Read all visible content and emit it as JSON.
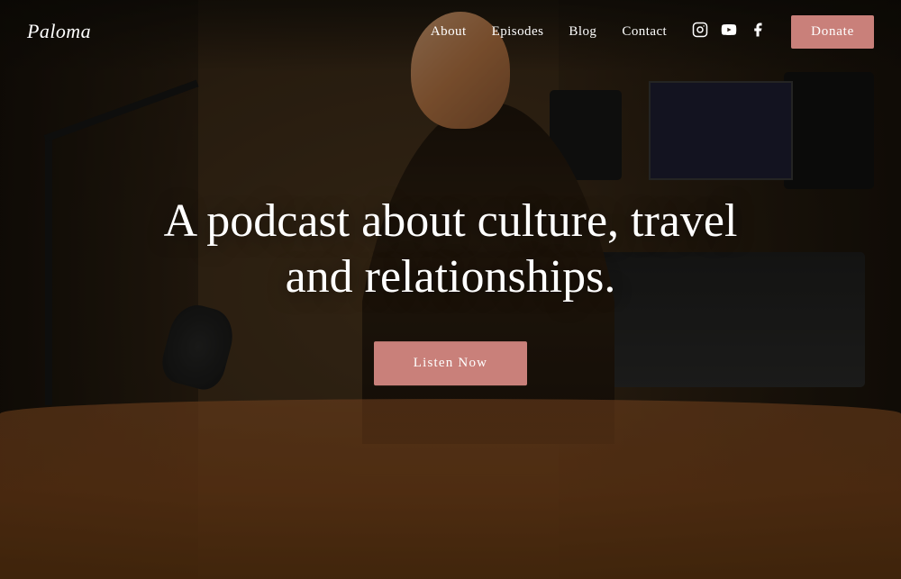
{
  "brand": {
    "name": "Paloma"
  },
  "nav": {
    "links": [
      {
        "label": "About",
        "name": "about"
      },
      {
        "label": "Episodes",
        "name": "episodes"
      },
      {
        "label": "Blog",
        "name": "blog"
      },
      {
        "label": "Contact",
        "name": "contact"
      }
    ],
    "donate_label": "Donate",
    "icons": [
      "instagram",
      "youtube",
      "facebook"
    ]
  },
  "hero": {
    "headline": "A podcast about culture, travel and relationships.",
    "cta_label": "Listen Now"
  },
  "colors": {
    "accent": "#c9807a",
    "text_light": "#ffffff"
  }
}
